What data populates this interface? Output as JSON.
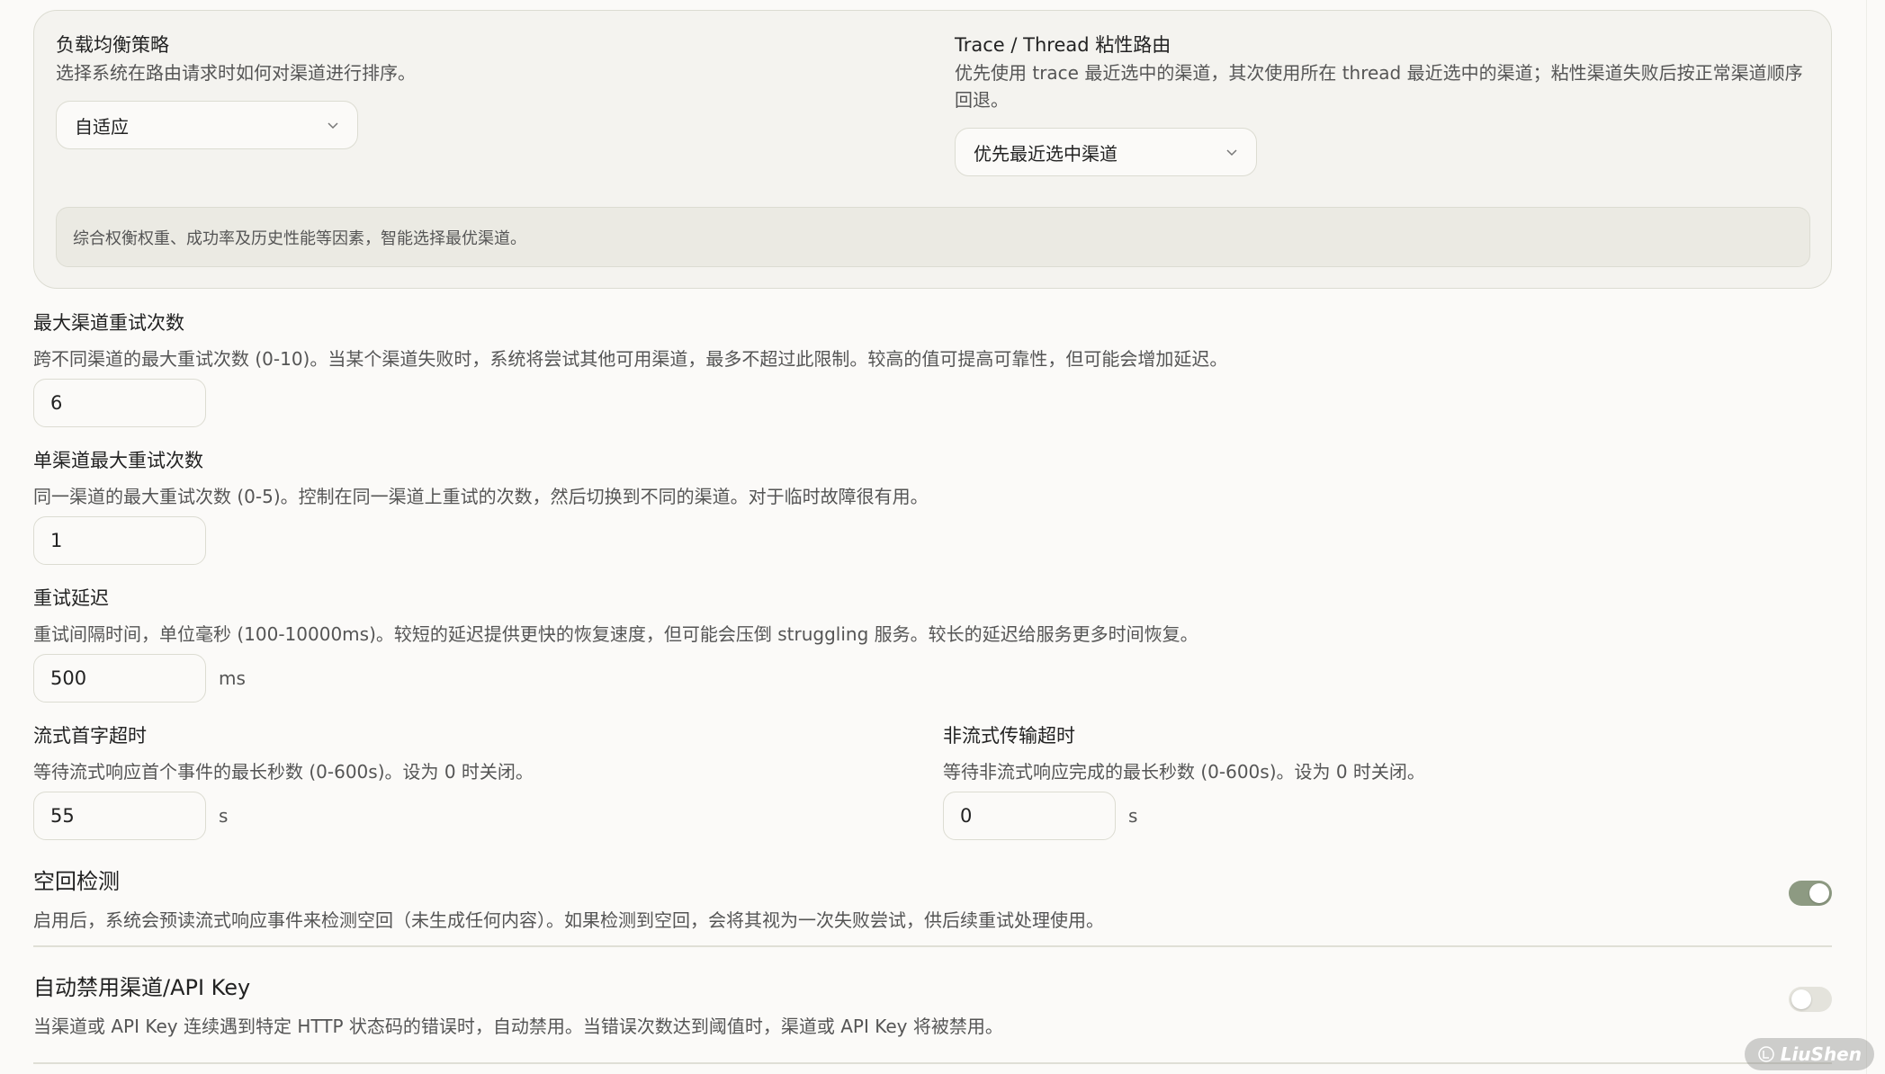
{
  "load_balance": {
    "strategy_title": "负载均衡策略",
    "strategy_desc": "选择系统在路由请求时如何对渠道进行排序。",
    "strategy_value": "自适应",
    "sticky_title": "Trace / Thread 粘性路由",
    "sticky_desc": "优先使用 trace 最近选中的渠道，其次使用所在 thread 最近选中的渠道；粘性渠道失败后按正常渠道顺序回退。",
    "sticky_value": "优先最近选中渠道",
    "note": "综合权衡权重、成功率及历史性能等因素，智能选择最优渠道。"
  },
  "max_channel_retries": {
    "title": "最大渠道重试次数",
    "desc": "跨不同渠道的最大重试次数 (0-10)。当某个渠道失败时，系统将尝试其他可用渠道，最多不超过此限制。较高的值可提高可靠性，但可能会增加延迟。",
    "value": "6"
  },
  "per_channel_retries": {
    "title": "单渠道最大重试次数",
    "desc": "同一渠道的最大重试次数 (0-5)。控制在同一渠道上重试的次数，然后切换到不同的渠道。对于临时故障很有用。",
    "value": "1"
  },
  "retry_delay": {
    "title": "重试延迟",
    "desc": "重试间隔时间，单位毫秒 (100-10000ms)。较短的延迟提供更快的恢复速度，但可能会压倒 struggling 服务。较长的延迟给服务更多时间恢复。",
    "value": "500",
    "unit": "ms"
  },
  "stream_first_token_timeout": {
    "title": "流式首字超时",
    "desc": "等待流式响应首个事件的最长秒数 (0-600s)。设为 0 时关闭。",
    "value": "55",
    "unit": "s"
  },
  "non_stream_timeout": {
    "title": "非流式传输超时",
    "desc": "等待非流式响应完成的最长秒数 (0-600s)。设为 0 时关闭。",
    "value": "0",
    "unit": "s"
  },
  "empty_response_detection": {
    "title": "空回检测",
    "desc": "启用后，系统会预读流式响应事件来检测空回（未生成任何内容）。如果检测到空回，会将其视为一次失败尝试，供后续重试处理使用。",
    "enabled": true
  },
  "auto_disable": {
    "title": "自动禁用渠道/API Key",
    "desc": "当渠道或 API Key 连续遇到特定 HTTP 状态码的错误时，自动禁用。当错误次数达到阈值时，渠道或 API Key 将被禁用。",
    "enabled": false
  },
  "watermark": "LiuShen",
  "colors": {
    "accent": "#8d9a82",
    "panel": "#f4f3ef",
    "border": "#dcdcd2"
  }
}
